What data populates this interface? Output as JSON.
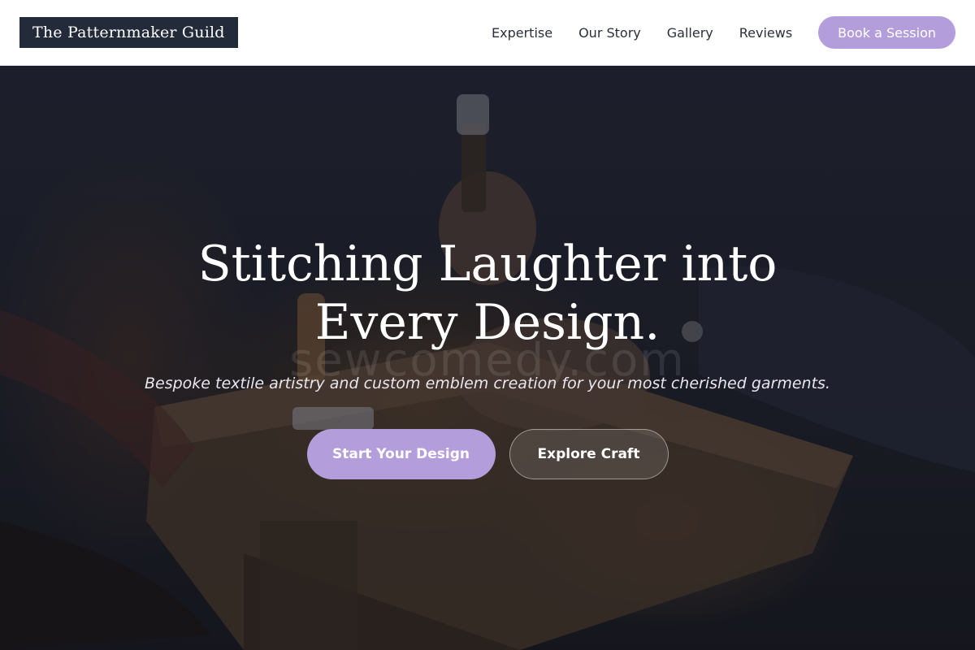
{
  "header": {
    "logo": "The Patternmaker Guild",
    "nav": [
      "Expertise",
      "Our Story",
      "Gallery",
      "Reviews"
    ],
    "cta": "Book a Session"
  },
  "hero": {
    "headline_line1": "Stitching Laughter into",
    "headline_line2": "Every Design.",
    "subheadline": "Bespoke textile artistry and custom emblem creation for your most cherished garments.",
    "watermark": "sewcomedy.com",
    "primary_button": "Start Your Design",
    "secondary_button": "Explore Craft"
  },
  "colors": {
    "accent": "#b39ddb",
    "logo_bg": "#232a3a",
    "header_bg": "#ffffff",
    "nav_text": "#2b2f3a"
  }
}
